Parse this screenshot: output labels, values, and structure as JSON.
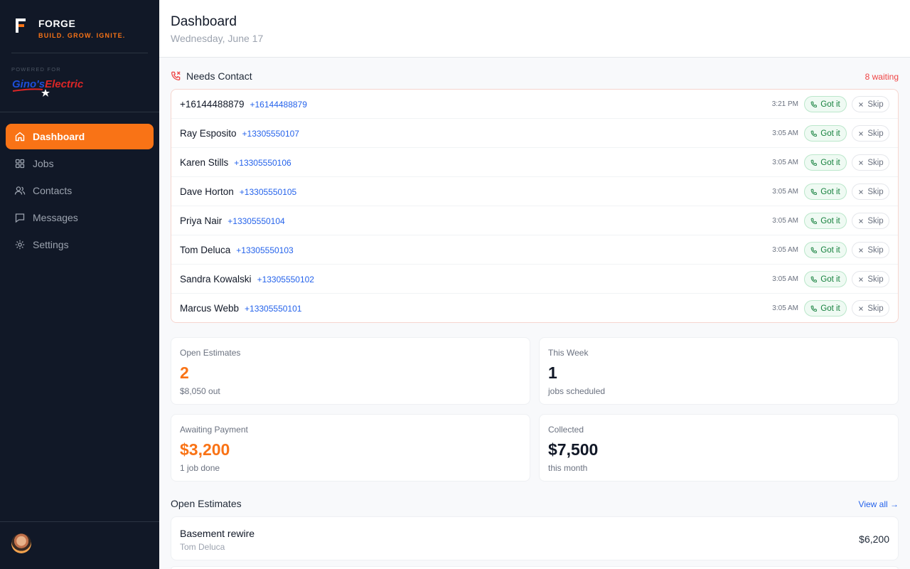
{
  "brand": {
    "name": "FORGE",
    "tagline": "BUILD. GROW. IGNITE.",
    "powered_for": "POWERED FOR",
    "partner_name": "Gino's Electric"
  },
  "nav": [
    {
      "label": "Dashboard",
      "icon": "home-icon",
      "active": true
    },
    {
      "label": "Jobs",
      "icon": "grid-icon",
      "active": false
    },
    {
      "label": "Contacts",
      "icon": "users-icon",
      "active": false
    },
    {
      "label": "Messages",
      "icon": "message-icon",
      "active": false
    },
    {
      "label": "Settings",
      "icon": "gear-icon",
      "active": false
    }
  ],
  "header": {
    "title": "Dashboard",
    "date": "Wednesday, June 17"
  },
  "needs_contact": {
    "title": "Needs Contact",
    "count_label": "8 waiting",
    "got_label": "Got it",
    "skip_label": "Skip",
    "rows": [
      {
        "name": "+16144488879",
        "phone": "+16144488879",
        "time": "3:21 PM"
      },
      {
        "name": "Ray Esposito",
        "phone": "+13305550107",
        "time": "3:05 AM"
      },
      {
        "name": "Karen Stills",
        "phone": "+13305550106",
        "time": "3:05 AM"
      },
      {
        "name": "Dave Horton",
        "phone": "+13305550105",
        "time": "3:05 AM"
      },
      {
        "name": "Priya Nair",
        "phone": "+13305550104",
        "time": "3:05 AM"
      },
      {
        "name": "Tom Deluca",
        "phone": "+13305550103",
        "time": "3:05 AM"
      },
      {
        "name": "Sandra Kowalski",
        "phone": "+13305550102",
        "time": "3:05 AM"
      },
      {
        "name": "Marcus Webb",
        "phone": "+13305550101",
        "time": "3:05 AM"
      }
    ]
  },
  "stats": {
    "open_estimates": {
      "label": "Open Estimates",
      "value": "2",
      "sub": "$8,050 out"
    },
    "this_week": {
      "label": "This Week",
      "value": "1",
      "sub": "jobs scheduled"
    },
    "awaiting_payment": {
      "label": "Awaiting Payment",
      "value": "$3,200",
      "sub": "1 job done"
    },
    "collected": {
      "label": "Collected",
      "value": "$7,500",
      "sub": "this month"
    }
  },
  "open_estimates": {
    "title": "Open Estimates",
    "view_all": "View all →",
    "items": [
      {
        "title": "Basement rewire",
        "client": "Tom Deluca",
        "amount": "$6,200"
      }
    ]
  },
  "colors": {
    "accent": "#f97316",
    "sidebar": "#111827",
    "link": "#2563eb",
    "alert": "#ef4444",
    "success": "#15803d"
  }
}
